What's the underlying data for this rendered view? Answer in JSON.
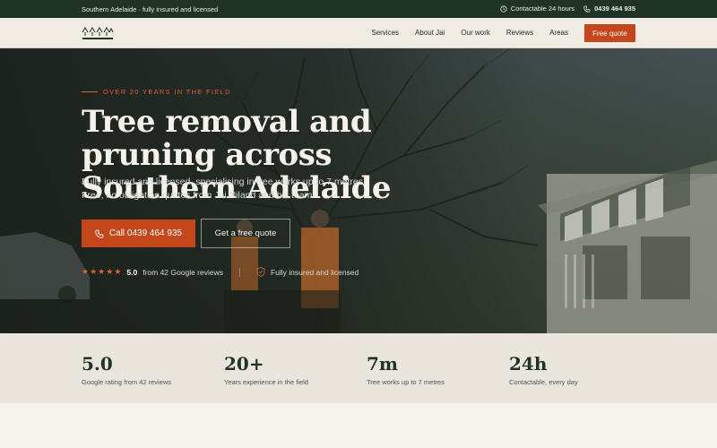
{
  "topbar": {
    "location": "Southern Adelaide · fully insured and licensed",
    "availability": "Contactable 24 hours",
    "phone": "0439 464 935"
  },
  "nav": {
    "links": [
      "Services",
      "About Jai",
      "Our work",
      "Reviews",
      "Areas"
    ],
    "cta": "Free quote"
  },
  "hero": {
    "eyebrow": "OVER 20 YEARS IN THE FIELD",
    "title": "Tree removal and pruning across Southern Adelaide",
    "lead": "Fully insured and licensed, specialising in tree works up to 7 metres. Free, no obligation quotes from Jai Niland and his team.",
    "call_button": "Call 0439 464 935",
    "quote_button": "Get a free quote",
    "rating_score": "5.0",
    "rating_text": "from 42 Google reviews",
    "insured_text": "Fully insured and licensed",
    "stars": 5
  },
  "stats": [
    {
      "value": "5.0",
      "label": "Google rating from 42 reviews"
    },
    {
      "value": "20+",
      "label": "Years experience in the field"
    },
    {
      "value": "7m",
      "label": "Tree works up to 7 metres"
    },
    {
      "value": "24h",
      "label": "Contactable, every day"
    }
  ],
  "colors": {
    "accent": "#c4461b",
    "dark_green": "#1f3326",
    "cream": "#f0ece4"
  }
}
